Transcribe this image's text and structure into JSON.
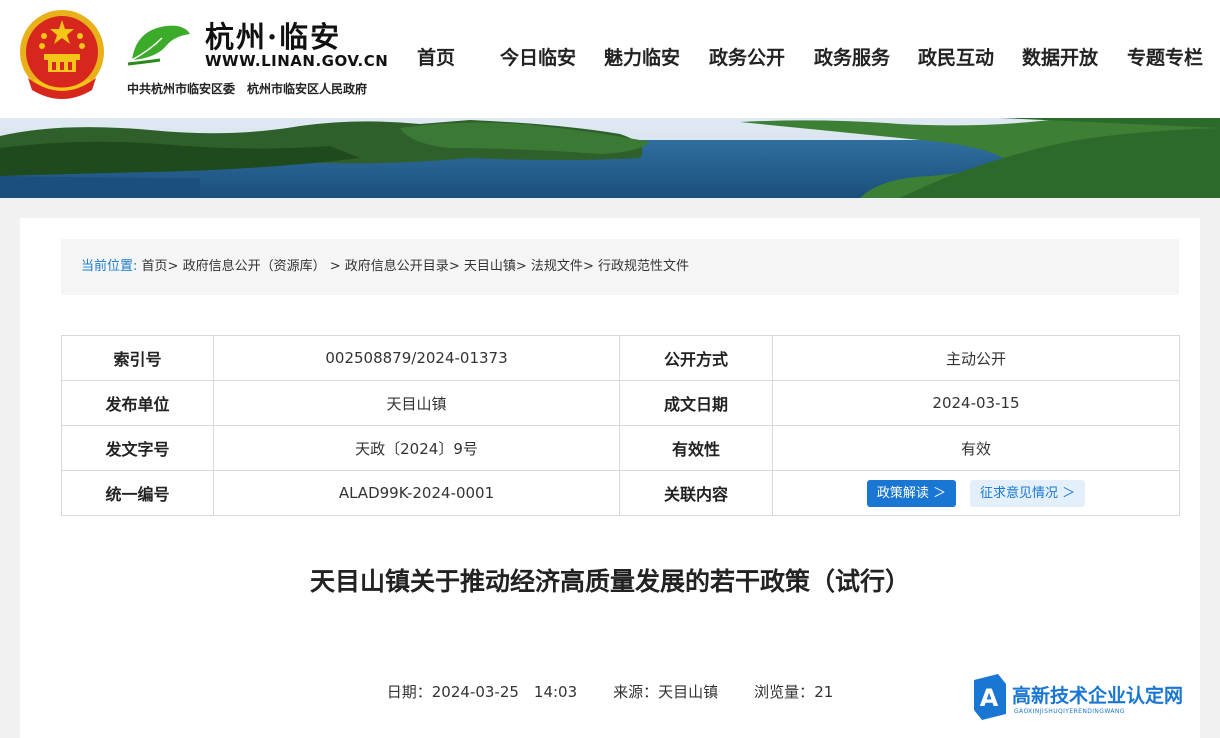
{
  "header": {
    "logo_calligraphy": "杭州·临安",
    "url": "WWW.LINAN.GOV.CN",
    "org": "中共杭州市临安区委　杭州市临安区人民政府",
    "nav": [
      "首页",
      "今日临安",
      "魅力临安",
      "政务公开",
      "政务服务",
      "政民互动",
      "数据开放",
      "专题专栏"
    ]
  },
  "breadcrumb": {
    "label": "当前位置:",
    "items": [
      "首页",
      "政府信息公开（资源库）",
      "政府信息公开目录",
      "天目山镇",
      "法规文件",
      "行政规范性文件"
    ],
    "separator": ">"
  },
  "info_table": {
    "rows": [
      {
        "k1": "索引号",
        "v1": "002508879/2024-01373",
        "k2": "公开方式",
        "v2": "主动公开"
      },
      {
        "k1": "发布单位",
        "v1": "天目山镇",
        "k2": "成文日期",
        "v2": "2024-03-15"
      },
      {
        "k1": "发文字号",
        "v1": "天政〔2024〕9号",
        "k2": "有效性",
        "v2": "有效"
      },
      {
        "k1": "统一编号",
        "v1": "ALAD99K-2024-0001",
        "k2": "关联内容",
        "v2": ""
      }
    ],
    "related_buttons": [
      "政策解读 ＞",
      "征求意见情况 ＞"
    ]
  },
  "article": {
    "title": "天目山镇关于推动经济高质量发展的若干政策（试行）",
    "date_label": "日期：",
    "date": "2024-03-25　14:03",
    "source_label": "来源：",
    "source": "天目山镇",
    "views_label": "浏览量：",
    "views": "21"
  },
  "watermark": {
    "text": "高新技术企业认定网",
    "sub": "GAOXINJISHUQIYERENDINGWANG",
    "badge_letter": "A"
  },
  "colors": {
    "accent": "#1976d2",
    "emblem_red": "#d7261d",
    "emblem_gold": "#f5c518",
    "leaf_green": "#3cab2a"
  }
}
